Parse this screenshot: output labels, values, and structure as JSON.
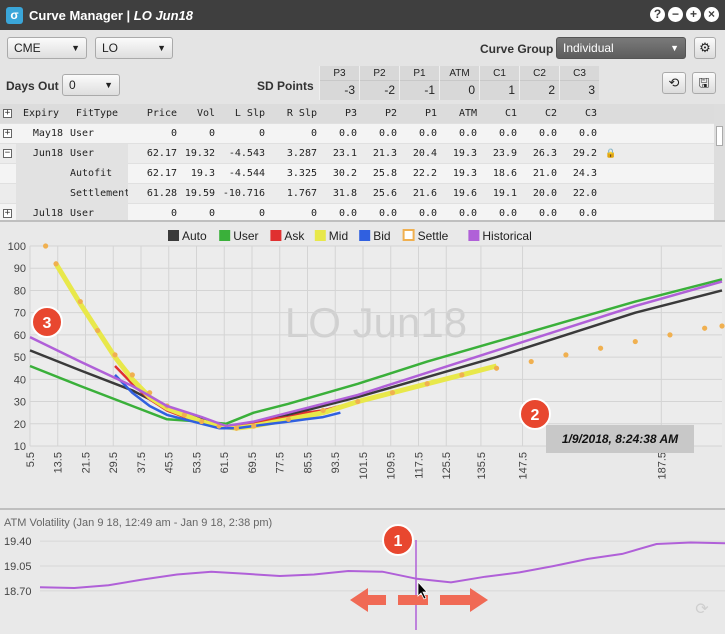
{
  "window": {
    "title": "Curve Manager | ",
    "title_italic": "LO Jun18",
    "buttons": [
      "?",
      "−",
      "+",
      "×"
    ]
  },
  "toolbar": {
    "exchange": "CME",
    "product": "LO",
    "curve_group_label": "Curve Group",
    "curve_group": "Individual",
    "settings_icon": "gear-icon",
    "days_out_label": "Days Out",
    "days_out": "0",
    "sd_points_label": "SD Points",
    "refresh_icon": "refresh-icon",
    "save_icon": "save-icon"
  },
  "sd_points": {
    "headers": [
      "P3",
      "P2",
      "P1",
      "ATM",
      "C1",
      "C2",
      "C3"
    ],
    "values": [
      "-3",
      "-2",
      "-1",
      "0",
      "1",
      "2",
      "3"
    ]
  },
  "table": {
    "columns": [
      "Expiry",
      "FitType",
      "Price",
      "Vol",
      "L Slp",
      "R Slp",
      "P3",
      "P2",
      "P1",
      "ATM",
      "C1",
      "C2",
      "C3"
    ],
    "rows": [
      {
        "expander": "+",
        "cells": [
          "May18",
          "User",
          "0",
          "0",
          "0",
          "0",
          "0.0",
          "0.0",
          "0.0",
          "0.0",
          "0.0",
          "0.0",
          "0.0"
        ]
      },
      {
        "expander": "−",
        "cells": [
          "Jun18",
          "User",
          "62.17",
          "19.32",
          "-4.543",
          "3.287",
          "23.1",
          "21.3",
          "20.4",
          "19.3",
          "23.9",
          "26.3",
          "29.2"
        ],
        "lock": true
      },
      {
        "expander": "",
        "cells": [
          "",
          "Autofit",
          "62.17",
          "19.3",
          "-4.544",
          "3.325",
          "30.2",
          "25.8",
          "22.2",
          "19.3",
          "18.6",
          "21.0",
          "24.3"
        ]
      },
      {
        "expander": "",
        "cells": [
          "",
          "Settlement",
          "61.28",
          "19.59",
          "-10.716",
          "1.767",
          "31.8",
          "25.6",
          "21.6",
          "19.6",
          "19.1",
          "20.0",
          "22.0"
        ]
      },
      {
        "expander": "+",
        "cells": [
          "Jul18",
          "User",
          "0",
          "0",
          "0",
          "0",
          "0.0",
          "0.0",
          "0.0",
          "0.0",
          "0.0",
          "0.0",
          "0.0"
        ]
      }
    ]
  },
  "chart_data": [
    {
      "type": "line",
      "title": "",
      "watermark": "LO Jun18",
      "timestamp": "1/9/2018, 8:24:38 AM",
      "xlabel": "",
      "ylabel": "",
      "xlim": [
        5.5,
        205
      ],
      "ylim": [
        10,
        100
      ],
      "grid": true,
      "legend_placement": "top",
      "x_ticks": [
        "5.5",
        "13.5",
        "21.5",
        "29.5",
        "37.5",
        "45.5",
        "53.5",
        "61.5",
        "69.5",
        "77.5",
        "85.5",
        "93.5",
        "101.5",
        "109.5",
        "117.5",
        "125.5",
        "135.5",
        "147.5",
        "187.5"
      ],
      "y_ticks": [
        "10",
        "20",
        "30",
        "40",
        "50",
        "60",
        "70",
        "80",
        "90",
        "100"
      ],
      "series": [
        {
          "name": "Auto",
          "color": "#3a3a3a",
          "style": "line",
          "x": [
            5.5,
            20,
            35,
            45,
            55,
            62,
            70,
            80,
            100,
            120,
            140,
            160,
            180,
            205
          ],
          "y": [
            53,
            44,
            35,
            27,
            22,
            19,
            20,
            24,
            32,
            41,
            50,
            60,
            70,
            80
          ]
        },
        {
          "name": "User",
          "color": "#3ab03a",
          "style": "line",
          "x": [
            5.5,
            20,
            35,
            45,
            55,
            62,
            70,
            80,
            100,
            120,
            140,
            160,
            180,
            205
          ],
          "y": [
            46,
            37,
            28,
            22,
            21,
            20,
            25,
            29,
            38,
            48,
            57,
            66,
            75,
            85
          ]
        },
        {
          "name": "Ask",
          "color": "#e03030",
          "style": "line",
          "x": [
            30,
            35,
            40,
            45,
            50,
            55,
            60,
            65,
            70,
            75,
            80,
            85,
            90,
            95
          ],
          "y": [
            46,
            38,
            31,
            26,
            23,
            21,
            19,
            19,
            20,
            22,
            23,
            25,
            26,
            28
          ]
        },
        {
          "name": "Mid",
          "color": "#e8e84a",
          "style": "line",
          "x": [
            13,
            20,
            25,
            30,
            35,
            40,
            45,
            50,
            55,
            60,
            65,
            70,
            80,
            90,
            100,
            110,
            120,
            130,
            140
          ],
          "y": [
            92,
            74,
            62,
            50,
            40,
            32,
            27,
            24,
            21,
            19,
            18,
            19,
            22,
            25,
            30,
            34,
            38,
            42,
            46
          ]
        },
        {
          "name": "Bid",
          "color": "#3060e0",
          "style": "line",
          "x": [
            30,
            35,
            40,
            45,
            50,
            55,
            60,
            65,
            70,
            75,
            80,
            85,
            90,
            95
          ],
          "y": [
            42,
            34,
            28,
            24,
            22,
            20,
            18,
            18,
            19,
            20,
            21,
            22,
            23,
            25
          ]
        },
        {
          "name": "Settle",
          "color": "#f0b050",
          "style": "dots",
          "x": [
            10,
            13,
            20,
            25,
            30,
            35,
            40,
            45,
            50,
            55,
            60,
            65,
            70,
            80,
            90,
            100,
            110,
            120,
            130,
            140,
            150,
            160,
            170,
            180,
            190,
            200,
            205
          ],
          "y": [
            100,
            92,
            75,
            62,
            51,
            42,
            34,
            28,
            24,
            21,
            19,
            18,
            19,
            22,
            26,
            30,
            34,
            38,
            42,
            45,
            48,
            51,
            54,
            57,
            60,
            63,
            64
          ]
        },
        {
          "name": "Historical",
          "color": "#b060d8",
          "style": "line",
          "x": [
            5.5,
            20,
            35,
            45,
            55,
            62,
            70,
            80,
            100,
            120,
            140,
            160,
            180,
            205
          ],
          "y": [
            59,
            48,
            37,
            28,
            23,
            19,
            21,
            25,
            33,
            43,
            53,
            63,
            73,
            84
          ]
        }
      ]
    },
    {
      "type": "line",
      "title": "ATM Volatility (Jan 9 18, 12:49 am - Jan 9 18, 2:38 pm)",
      "y_ticks": [
        "19.40",
        "19.05",
        "18.70"
      ],
      "ylim": [
        18.6,
        19.5
      ],
      "series": [
        {
          "name": "",
          "color": "#b060d8",
          "x": [
            0,
            5,
            10,
            15,
            20,
            25,
            30,
            35,
            40,
            45,
            50,
            55,
            60,
            65,
            70,
            75,
            80,
            85,
            90,
            95,
            100
          ],
          "y": [
            18.75,
            18.74,
            18.78,
            18.86,
            18.93,
            18.97,
            18.94,
            18.91,
            18.93,
            18.98,
            18.97,
            18.87,
            18.82,
            18.9,
            18.96,
            19.05,
            19.15,
            19.22,
            19.36,
            19.38,
            19.37
          ]
        }
      ]
    }
  ],
  "annotations": [
    {
      "number": "1"
    },
    {
      "number": "2"
    },
    {
      "number": "3"
    }
  ],
  "colors": {
    "annotation": "#e8472f",
    "arrow": "#f06a55",
    "marker": "#b060d8"
  }
}
